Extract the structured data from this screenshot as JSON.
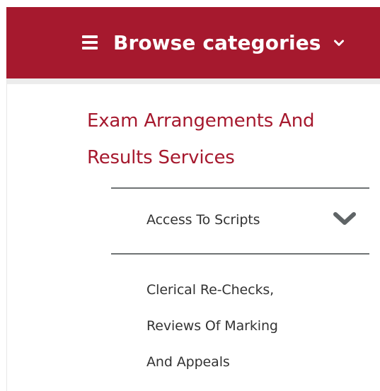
{
  "header": {
    "title": "Browse categories",
    "menu_icon": "hamburger-menu-icon",
    "dropdown_icon": "chevron-down-icon",
    "background_color": "#a6192e",
    "text_color": "#ffffff"
  },
  "category": {
    "title_line1": "Exam Arrangements And",
    "title_line2": "Results Services",
    "color": "#a6192e"
  },
  "subcategories": [
    {
      "label": "Access To Scripts",
      "icon": "chevron-down-icon"
    },
    {
      "label_line1": "Clerical Re-Checks,",
      "label_line2": "Reviews Of Marking",
      "label_line3": "And Appeals"
    }
  ]
}
